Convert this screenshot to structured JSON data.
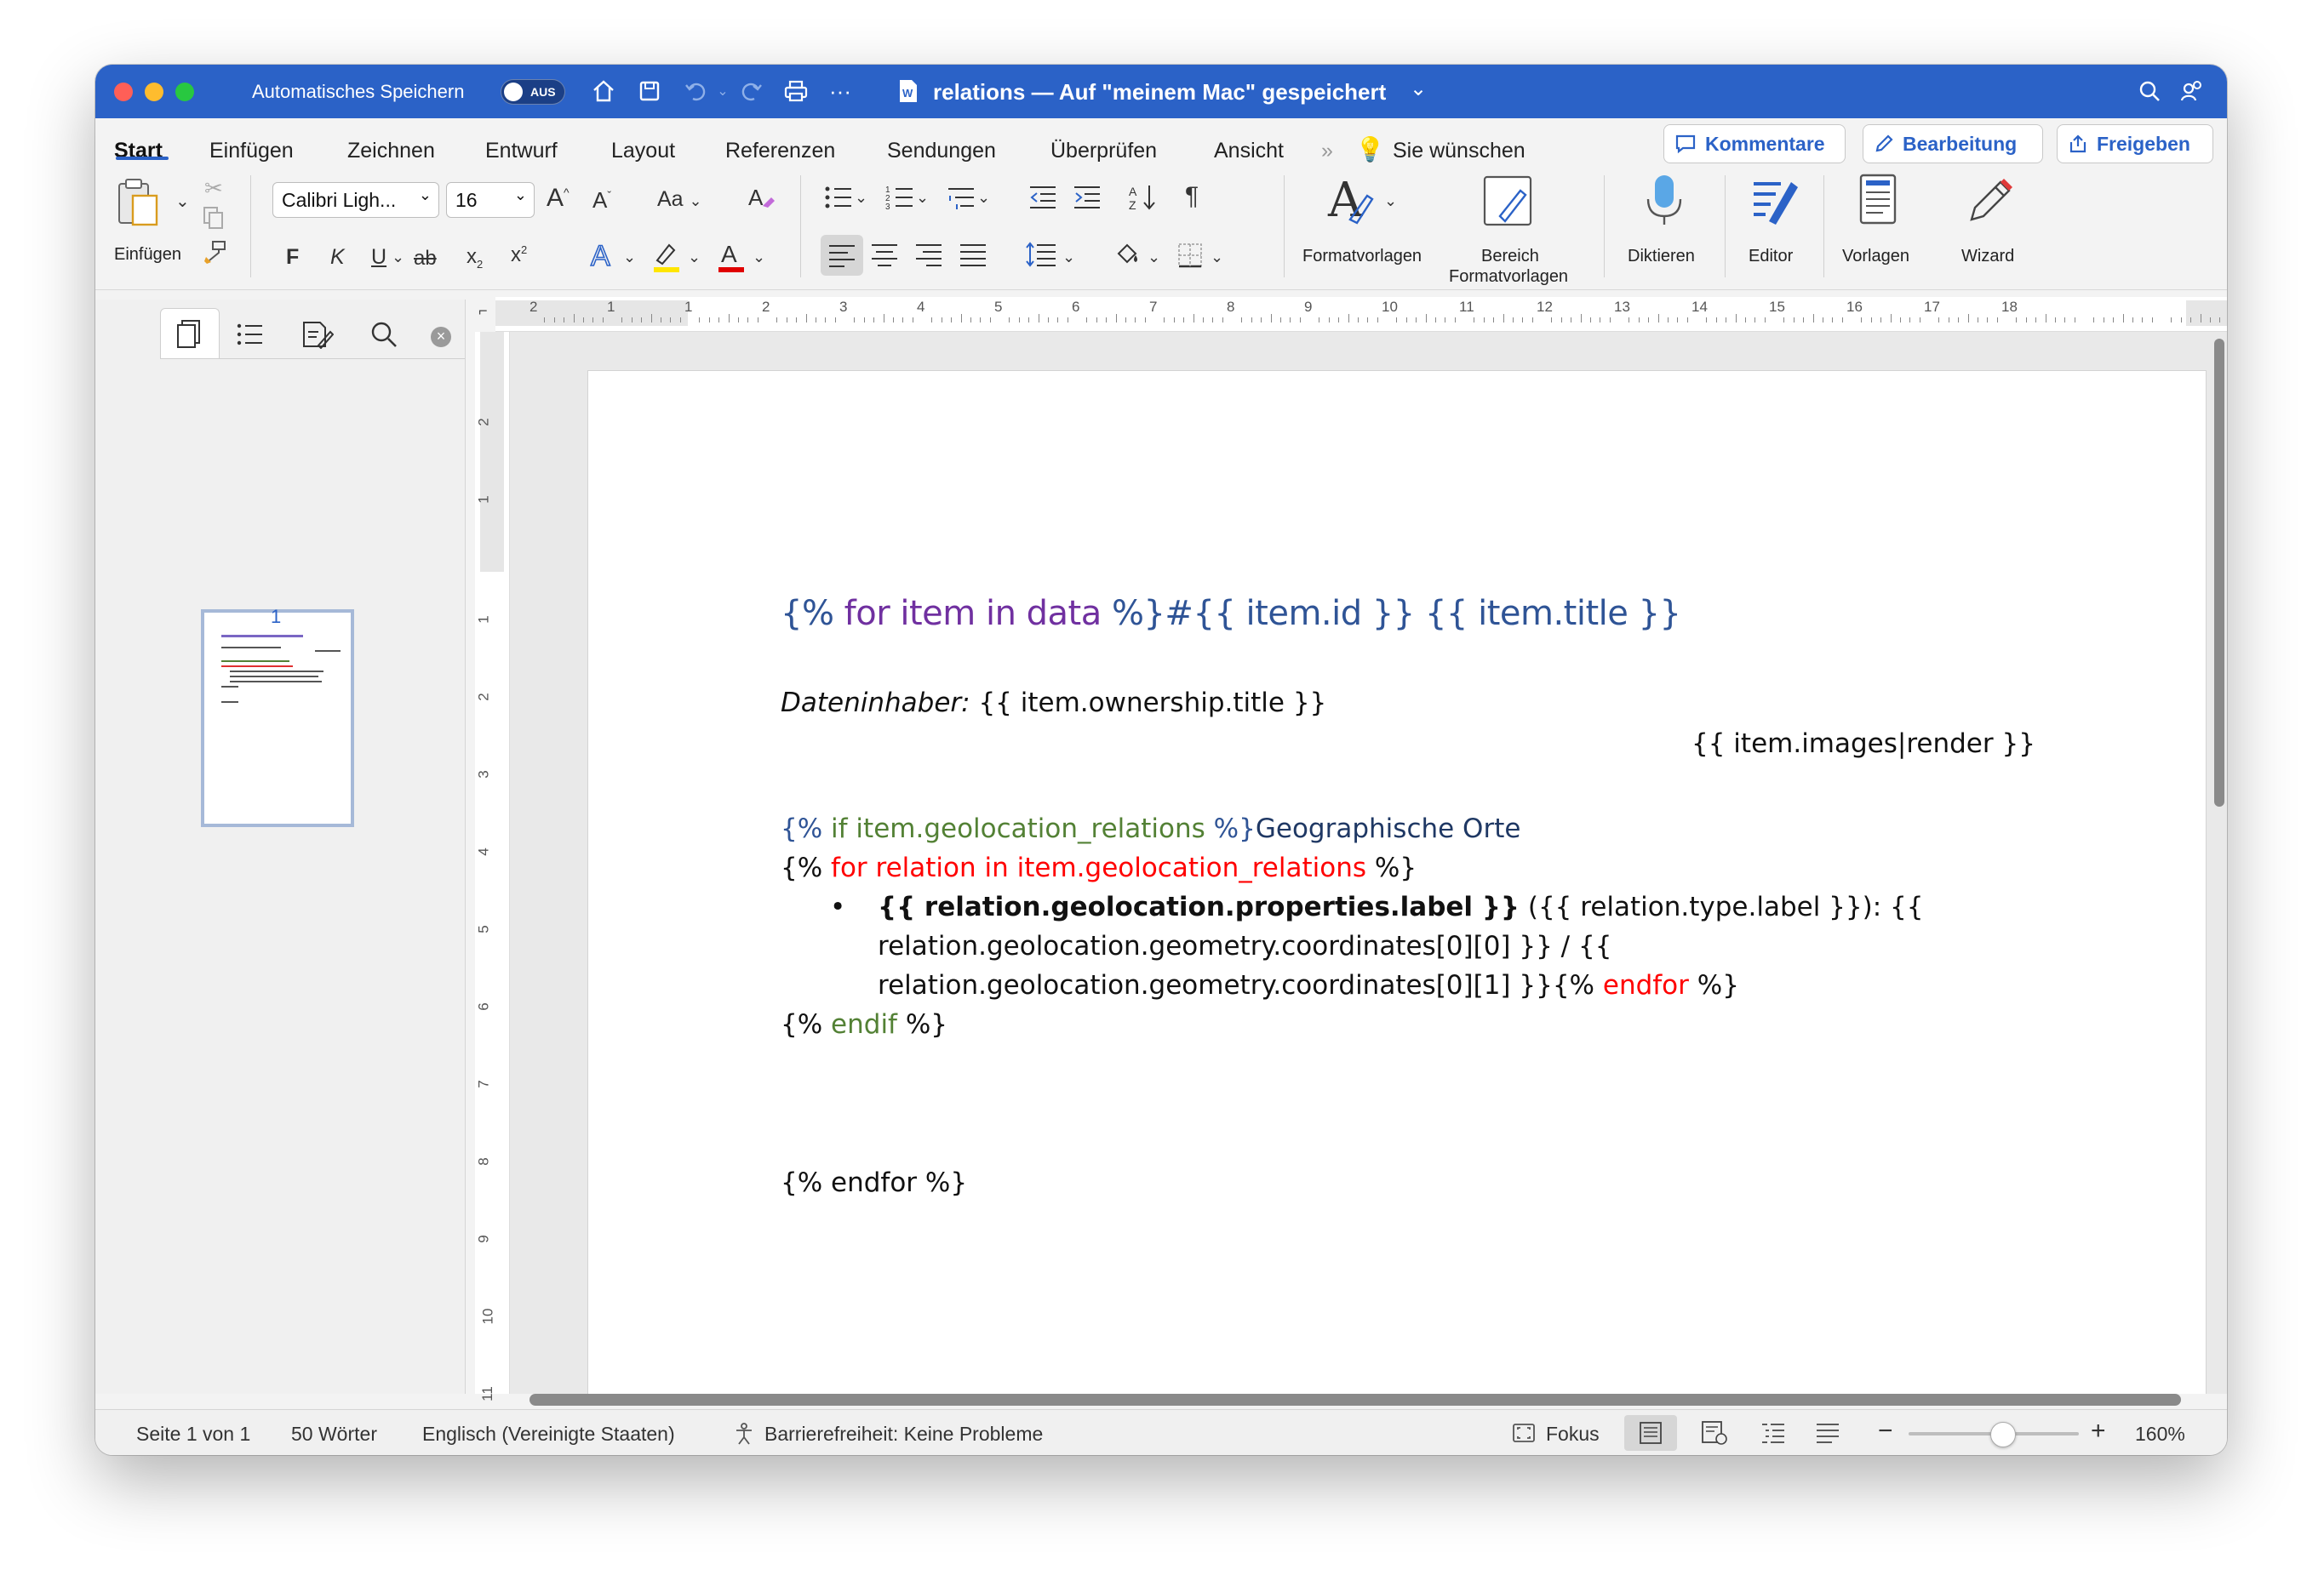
{
  "titlebar": {
    "autosave_label": "Automatisches Speichern",
    "autosave_state": "AUS",
    "document_title": "relations — Auf \"meinem Mac\" gespeichert"
  },
  "tabs": [
    "Start",
    "Einfügen",
    "Zeichnen",
    "Entwurf",
    "Layout",
    "Referenzen",
    "Sendungen",
    "Überprüfen",
    "Ansicht"
  ],
  "tell_me": "Sie wünschen",
  "actions": {
    "comments": "Kommentare",
    "editing": "Bearbeitung",
    "share": "Freigeben"
  },
  "ribbon": {
    "paste_label": "Einfügen",
    "font_name": "Calibri Ligh...",
    "font_size": "16",
    "grow_font": "A",
    "shrink_font": "A",
    "change_case": "Aa",
    "bold": "F",
    "italic": "K",
    "underline": "U",
    "strikethrough": "ab",
    "subscript": "x",
    "superscript": "x",
    "styles_label": "Formatvorlagen",
    "styles_pane_line1": "Bereich",
    "styles_pane_line2": "Formatvorlagen",
    "dictate_label": "Diktieren",
    "editor_label": "Editor",
    "templates_label": "Vorlagen",
    "wizard_label": "Wizard"
  },
  "nav": {
    "page_number": "1"
  },
  "ruler": {
    "h_labels": [
      "2",
      "1",
      "1",
      "2",
      "3",
      "4",
      "5",
      "6",
      "7",
      "8",
      "9",
      "10",
      "11",
      "12",
      "13",
      "14",
      "15",
      "16",
      "17",
      "18"
    ],
    "v_labels": [
      "2",
      "1",
      "1",
      "2",
      "3",
      "4",
      "5",
      "6",
      "7",
      "8",
      "9",
      "10",
      "11"
    ]
  },
  "document": {
    "heading": {
      "part1": "{% ",
      "part2": "for item in data",
      "part3": " %}#{{ item.id }} {{ item.title }}"
    },
    "owner_label": "Dateninhaber:",
    "owner_value": " {{ item.ownership.title }}",
    "images_render": "{{ item.images|render }}",
    "if_line": {
      "part1": "{% ",
      "part2": "if item.geolocation_relations",
      "part3": " %}",
      "part4": "Geographische Orte"
    },
    "for_line": {
      "part1": "{% ",
      "part2": "for relation in item.geolocation_relations",
      "part3": " %}"
    },
    "bullet": {
      "bold": "{{ relation.geolocation.properties.label }}",
      "rest1": " ({{ relation.type.label }}): {{",
      "line2": "relation.geolocation.geometry.coordinates[0][0] }} / {{",
      "line3a": "relation.geolocation.geometry.coordinates[0][1] }}{% ",
      "line3b": "endfor",
      "line3c": " %}"
    },
    "endif_line": {
      "part1": "{% ",
      "part2": "endif",
      "part3": " %}"
    },
    "endfor_line": "{% endfor %}"
  },
  "statusbar": {
    "page": "Seite 1 von 1",
    "words": "50 Wörter",
    "language": "Englisch (Vereinigte Staaten)",
    "accessibility": "Barrierefreiheit: Keine Probleme",
    "focus": "Fokus",
    "zoom": "160%",
    "zoom_fraction": 0.55
  },
  "colors": {
    "titlebar": "#2b62c7",
    "heading_blue": "#2f5496",
    "heading_purple": "#7030a0",
    "green": "#538135",
    "red": "#ff0000"
  }
}
